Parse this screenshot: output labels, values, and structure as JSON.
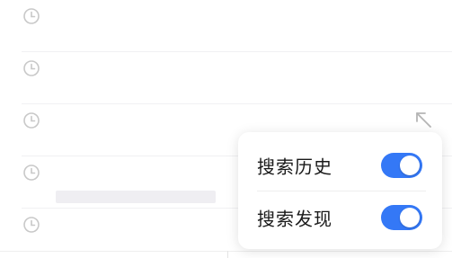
{
  "history": {
    "rows": [
      {
        "icon": "clock-icon"
      },
      {
        "icon": "clock-icon"
      },
      {
        "icon": "clock-icon"
      },
      {
        "icon": "clock-icon"
      },
      {
        "icon": "clock-icon"
      }
    ]
  },
  "popup": {
    "items": [
      {
        "label": "搜索历史",
        "enabled": true
      },
      {
        "label": "搜索发现",
        "enabled": true
      }
    ]
  },
  "colors": {
    "toggle_on": "#3478f6",
    "icon_gray": "#c8c8c8"
  }
}
